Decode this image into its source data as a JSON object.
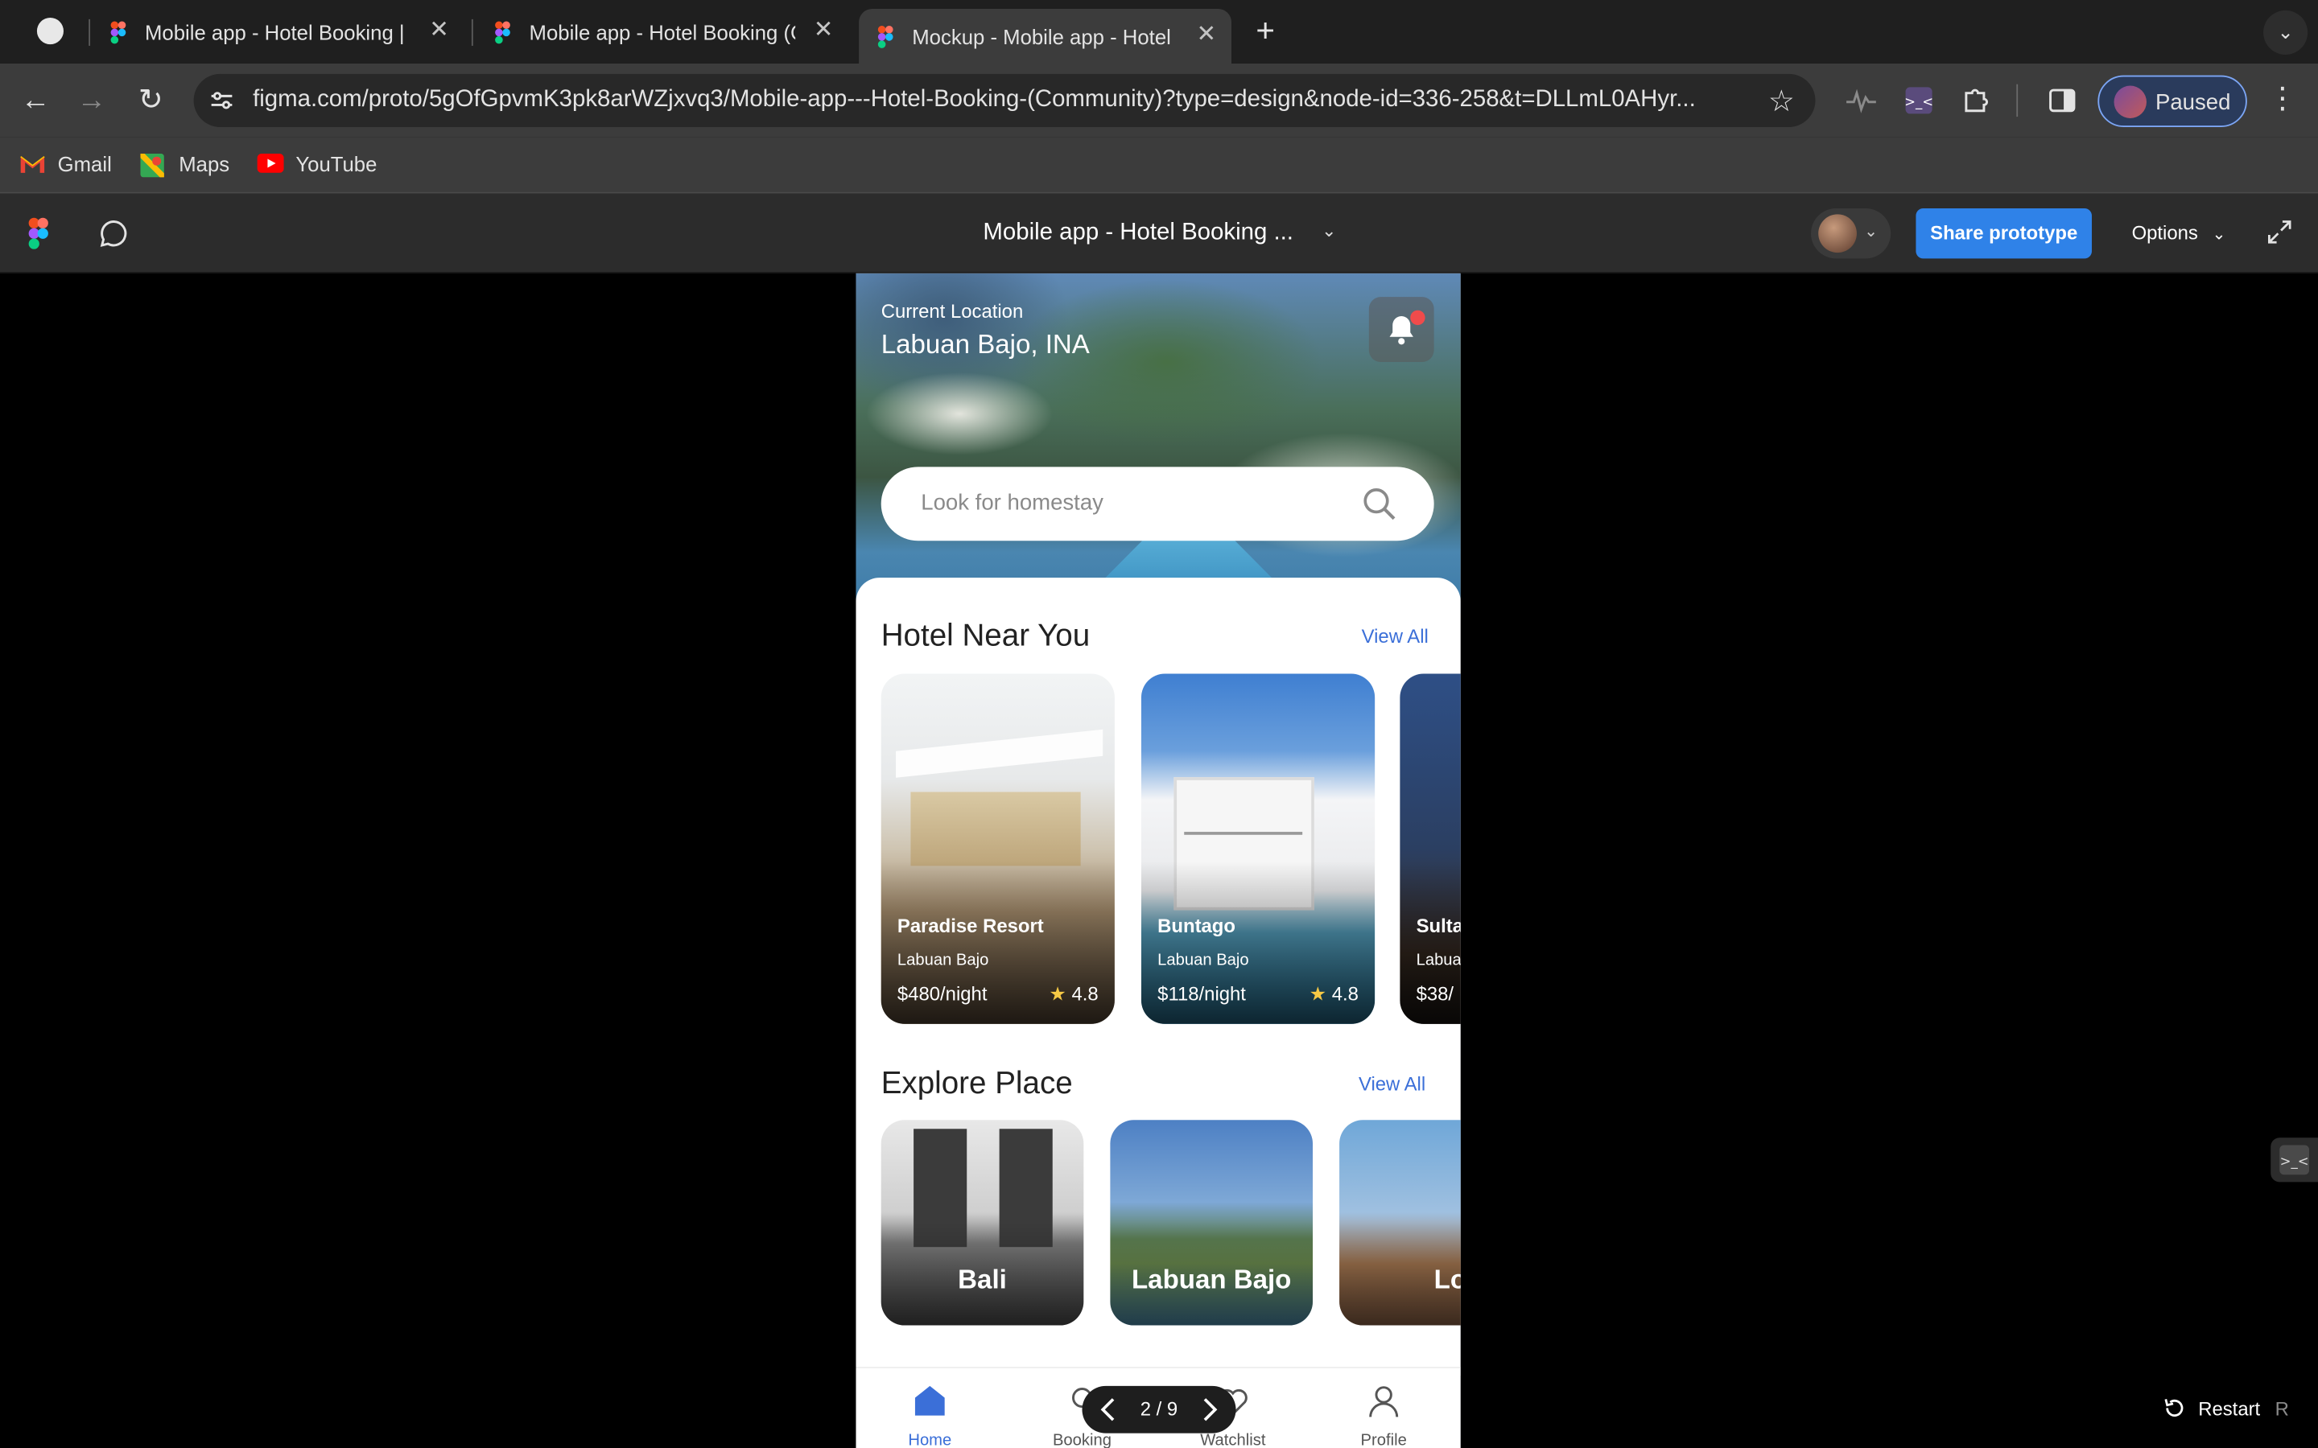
{
  "browser": {
    "tabs": [
      {
        "title": "Mobile app - Hotel Booking | F"
      },
      {
        "title": "Mobile app - Hotel Booking (C"
      },
      {
        "title": "Mockup - Mobile app - Hotel"
      }
    ],
    "url": "figma.com/proto/5gOfGpvmK3pk8arWZjxvq3/Mobile-app---Hotel-Booking-(Community)?type=design&node-id=336-258&t=DLLmL0AHyr...",
    "profile_label": "Paused",
    "bookmarks": [
      {
        "label": "Gmail"
      },
      {
        "label": "Maps"
      },
      {
        "label": "YouTube"
      }
    ]
  },
  "figma": {
    "file_title": "Mobile app - Hotel Booking ...",
    "share_label": "Share prototype",
    "options_label": "Options",
    "pager": "2 / 9",
    "restart_label": "Restart",
    "restart_key": "R"
  },
  "app": {
    "current_location_label": "Current Location",
    "current_location": "Labuan Bajo, INA",
    "search_placeholder": "Look for homestay",
    "hotel_section": {
      "title": "Hotel Near You",
      "view_all": "View All",
      "hotels": [
        {
          "name": "Paradise Resort",
          "city": "Labuan Bajo",
          "price": "$480/",
          "unit": "night",
          "rating": "4.8"
        },
        {
          "name": "Buntago",
          "city": "Labuan Bajo",
          "price": "$118/",
          "unit": "night",
          "rating": "4.8"
        },
        {
          "name": "Sulta",
          "city": "Labua",
          "price": "$38/"
        }
      ]
    },
    "explore_section": {
      "title": "Explore Place",
      "view_all": "View All",
      "places": [
        {
          "name": "Bali"
        },
        {
          "name": "Labuan Bajo"
        },
        {
          "name": "Lomb"
        }
      ]
    },
    "tabbar": [
      {
        "label": "Home"
      },
      {
        "label": "Booking"
      },
      {
        "label": "Watchlist"
      },
      {
        "label": "Profile"
      }
    ],
    "accent_color": "#3b6fd8"
  }
}
